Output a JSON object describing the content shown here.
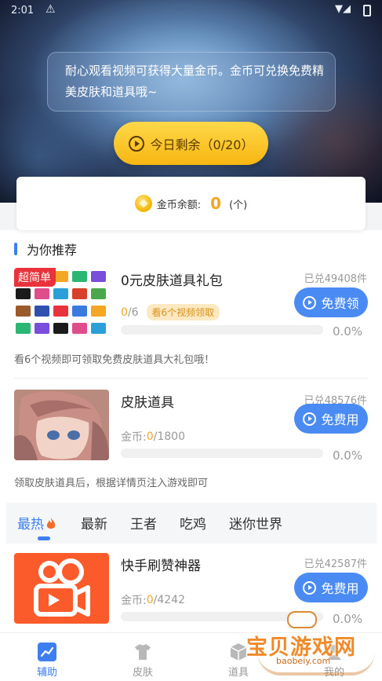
{
  "status_bar": {
    "time": "2:01"
  },
  "hero": {
    "notice": "耐心观看视频可获得大量金币。金币可兑换免费精美皮肤和道具哦~",
    "today_button": {
      "label": "今日剩余（0/20）"
    }
  },
  "balance": {
    "label": "金币余额:",
    "amount": "0",
    "unit": "(个)"
  },
  "recommend": {
    "title": "为你推荐",
    "items": [
      {
        "title": "0元皮肤道具礼包",
        "badge": "超简单",
        "redeemed": "已兑49408件",
        "button": "免费领",
        "progress_current": "0",
        "progress_total": "/6",
        "tag": "看6个视频领取",
        "percent": "0.0%",
        "progress_fraction": 0,
        "description": "看6个视频即可领取免费皮肤道具大礼包哦！"
      },
      {
        "title": "皮肤道具",
        "redeemed": "已兑48576件",
        "button": "免费用",
        "coin_label": "金币: ",
        "progress_current": "0",
        "progress_total": "/1800",
        "percent": "0.0%",
        "progress_fraction": 0,
        "description": "领取皮肤道具后，根据详情页注入游戏即可"
      }
    ]
  },
  "tabs": {
    "items": [
      "最热",
      "最新",
      "王者",
      "吃鸡",
      "迷你世界"
    ],
    "active_index": 0
  },
  "list": {
    "items": [
      {
        "title": "快手刷赞神器",
        "redeemed": "已兑42587件",
        "button": "免费用",
        "coin_label": "金币: ",
        "progress_current": "0",
        "progress_total": "/4242",
        "percent": "0.0%",
        "progress_fraction": 0
      }
    ]
  },
  "bottom_nav": {
    "items": [
      {
        "label": "辅助",
        "icon": "chart-icon",
        "active": true
      },
      {
        "label": "皮肤",
        "icon": "shirt-icon",
        "active": false
      },
      {
        "label": "道具",
        "icon": "cube-icon",
        "active": false
      },
      {
        "label": "我的",
        "icon": "user-icon",
        "active": false
      }
    ]
  },
  "watermark": {
    "text": "宝贝游戏网",
    "url": "baobeiy.com"
  },
  "colors": {
    "accent": "#3d7ef0",
    "gold": "#f5a623",
    "button_yellow": "#ffd84a"
  }
}
